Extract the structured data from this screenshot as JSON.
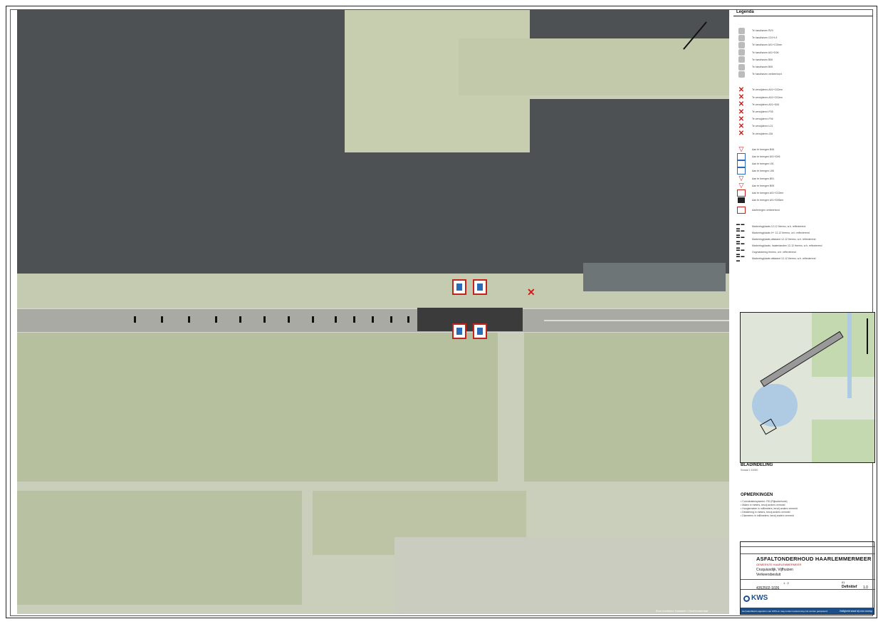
{
  "legend": {
    "title": "Legenda",
    "groups": [
      {
        "symbol": "grey-sign",
        "text": "Te handhaven RVV"
      },
      {
        "symbol": "grey-sign",
        "text": "Te handhaven C01+L9"
      },
      {
        "symbol": "grey-sign",
        "text": "Te handhaven A01+C02em"
      },
      {
        "symbol": "grey-sign",
        "text": "Te handhaven A01+D06"
      },
      {
        "symbol": "grey-sign",
        "text": "Te handhaven B06"
      },
      {
        "symbol": "grey-sign",
        "text": "Te handhaven B05"
      },
      {
        "symbol": "grey-sign",
        "text": "Te handhaven verkeerbord"
      },
      {
        "symbol": "red-x",
        "text": "Te verwijderen A01+C02em"
      },
      {
        "symbol": "red-x",
        "text": "Te verwijderen A01+C02em"
      },
      {
        "symbol": "red-x",
        "text": "Te verwijderen A01+D06"
      },
      {
        "symbol": "red-x",
        "text": "Te verwijderen F05"
      },
      {
        "symbol": "red-x",
        "text": "Te verwijderen F06"
      },
      {
        "symbol": "red-x",
        "text": "Te verwijderen L01"
      },
      {
        "symbol": "red-x",
        "text": "Te verwijderen J36"
      },
      {
        "symbol": "red-tri",
        "text": "Aan te brengen B06"
      },
      {
        "symbol": "blue-sign",
        "text": "Aan te brengen A01+D06"
      },
      {
        "symbol": "blue-sign",
        "text": "Aan te brengen L51"
      },
      {
        "symbol": "blue-sign",
        "text": "Aan te brengen L56"
      },
      {
        "symbol": "red-tri",
        "text": "Aan te brengen B51"
      },
      {
        "symbol": "red-tri",
        "text": "Aan te brengen B05"
      },
      {
        "symbol": "red-sign",
        "text": "Aan te brengen A01+C02em"
      },
      {
        "symbol": "dark-sign",
        "text": "Aan te brengen A01+D06em"
      },
      {
        "symbol": "red-sign",
        "text": "Aanbrengen verkeerbord"
      },
      {
        "symbol": "dashes",
        "text": "Markering/plaats 12-12 thermo, w.h. reflecterend"
      },
      {
        "symbol": "dashes",
        "text": "Markering/plaats H+ 12-12 thermo, w.h. reflecterend"
      },
      {
        "symbol": "dashes",
        "text": "Markering/plaats afslaand 12-12 thermo, w.h. reflecterend"
      },
      {
        "symbol": "dashes",
        "text": "Markering/plaats, haaientanden 12-12 thermo, w.h. reflecterend"
      },
      {
        "symbol": "dashes",
        "text": "Oogmarkering thermo, w.h. reflecterend"
      },
      {
        "symbol": "dashes",
        "text": "Markering/plaats afslaand 12-12 thermo, w.h. reflecterend"
      }
    ]
  },
  "overview": {
    "title": "BLADINDELING",
    "subtitle": "Schaal 1:10000"
  },
  "remarks": {
    "title": "OPMERKINGEN",
    "items": [
      "• Coördinatensysteem: RD (Rijksdriehoek)",
      "• Maten in meters, tenzij anders vermeld",
      "• Hoogtematen in millimeters, tenzij anders vermeld",
      "• Detailering in meters, tenzij anders vermeld",
      "• Diameters in millimeters, tenzij anders vermeld"
    ]
  },
  "titleblock": {
    "title": "ASFALTONDERHOUD HAARLEMMERMEER",
    "client_label": "GEMEENTE HAARLEMMERMEER",
    "sub1": "Cruquiusdijk, Vijfhuizen",
    "sub2": "Verkeersbesluit",
    "project_no": "4352502-1026",
    "scale": "1 : 2",
    "sheet": "01",
    "status": "Definitief",
    "version": "1.0",
    "company": "KWS",
    "footer_left": "Het tekenblad is eigendom van KWS en mag zonder toestemming niet worden gekopieerd",
    "footer_right": "Veiligheid staat bij ons voorop"
  },
  "map": {
    "credit": "Bron luchtfoto: Kadaster / Beeldmateriaal"
  }
}
